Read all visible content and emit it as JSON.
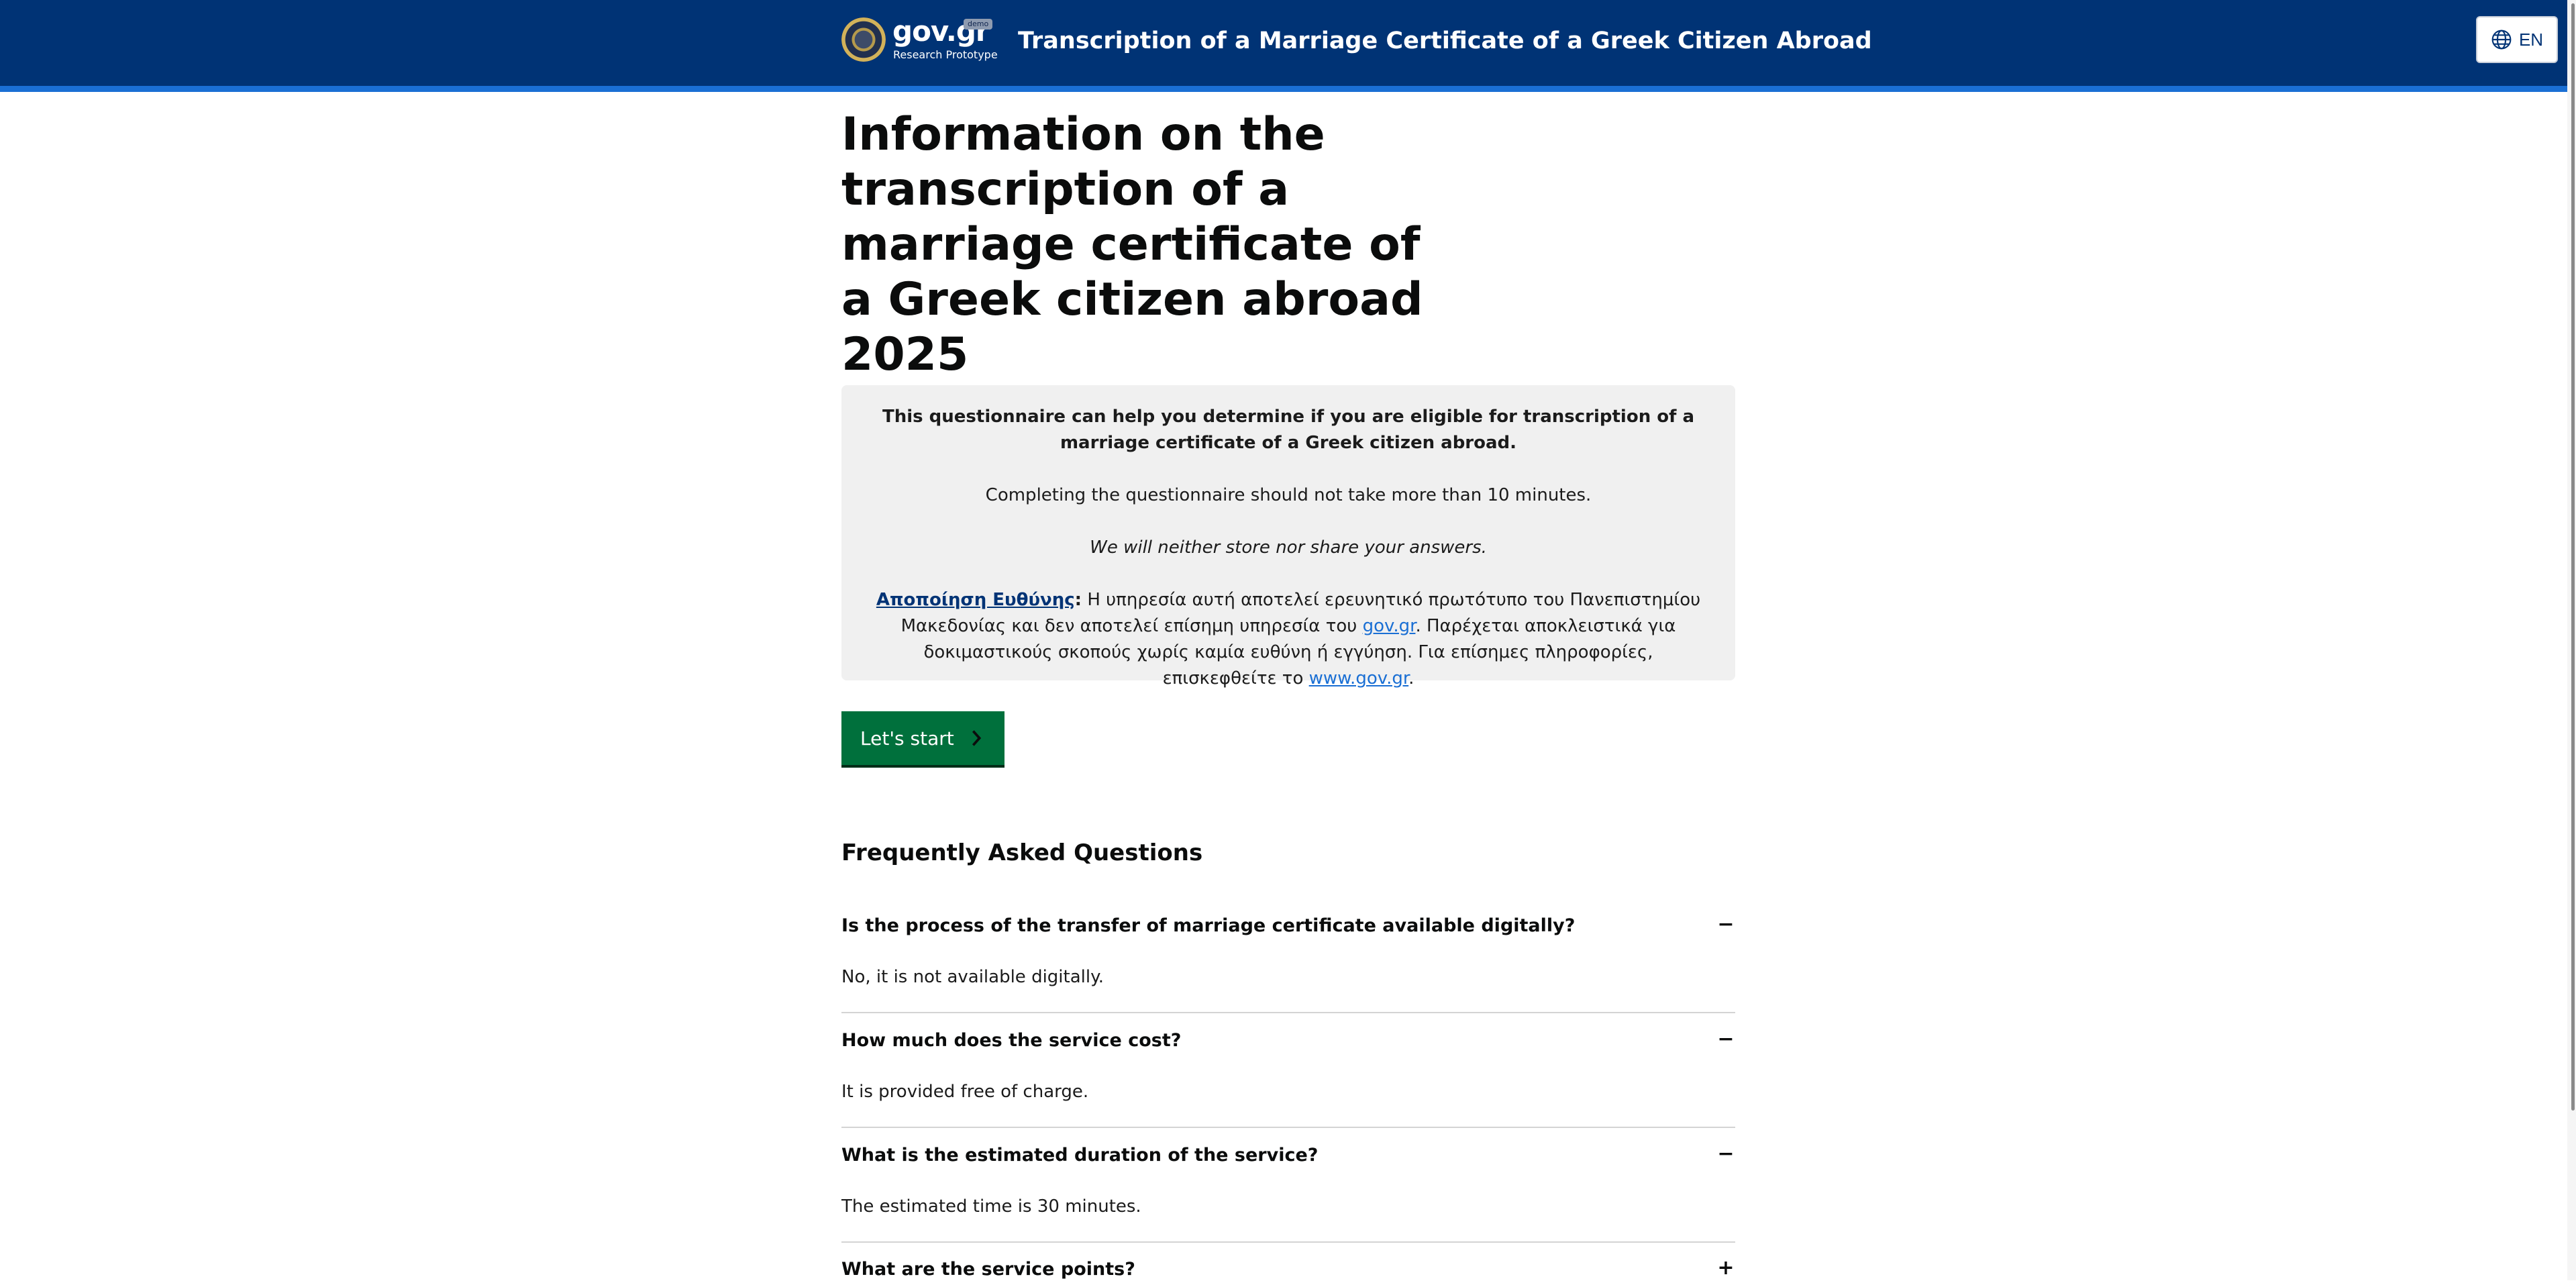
{
  "header": {
    "logo_wordmark": "gov.gr",
    "logo_badge": "demo",
    "logo_subtitle": "Research Prototype",
    "title": "Transcription of a Marriage Certificate of a Greek Citizen Abroad",
    "language_button": "EN",
    "background_color": "#003375",
    "accent_color": "#1a6fd4"
  },
  "main": {
    "page_title": "Information on the transcription of a marriage certificate of a Greek citizen abroad 2025",
    "info": {
      "intro": "This questionnaire can help you determine if you are eligible for transcription of a marriage certificate of a Greek citizen abroad.",
      "duration": "Completing the questionnaire should not take more than 10 minutes.",
      "privacy": "We will neither store nor share your answers.",
      "disclaimer_label": "Αποποίηση Ευθύνης",
      "disclaimer_colon": ":",
      "disclaimer_text_1": " Η υπηρεσία αυτή αποτελεί ερευνητικό πρωτότυπο του Πανεπιστημίου Μακεδονίας και δεν αποτελεί επίσημη υπηρεσία του ",
      "disclaimer_link_1": "gov.gr",
      "disclaimer_text_2": ". Παρέχεται αποκλειστικά για δοκιμαστικούς σκοπούς χωρίς καμία ευθύνη ή εγγύηση. Για επίσημες πληροφορίες, επισκεφθείτε το ",
      "disclaimer_link_2": "www.gov.gr",
      "disclaimer_text_3": "."
    },
    "start_button": "Let's start",
    "start_button_color": "#00703c"
  },
  "faq": {
    "title": "Frequently Asked Questions",
    "items": [
      {
        "question": "Is the process of the transfer of marriage certificate available digitally?",
        "answer": "No, it is not available digitally.",
        "toggle": "−"
      },
      {
        "question": "How much does the service cost?",
        "answer": "It is provided free of charge.",
        "toggle": "−"
      },
      {
        "question": "What is the estimated duration of the service?",
        "answer": "The estimated time is 30 minutes.",
        "toggle": "−"
      },
      {
        "question": "What are the service points?",
        "answer": "",
        "toggle": "+"
      }
    ]
  },
  "icons": {
    "language": "globe-icon",
    "start_arrow": "chevron-right-icon",
    "logo": "greek-seal-icon"
  }
}
